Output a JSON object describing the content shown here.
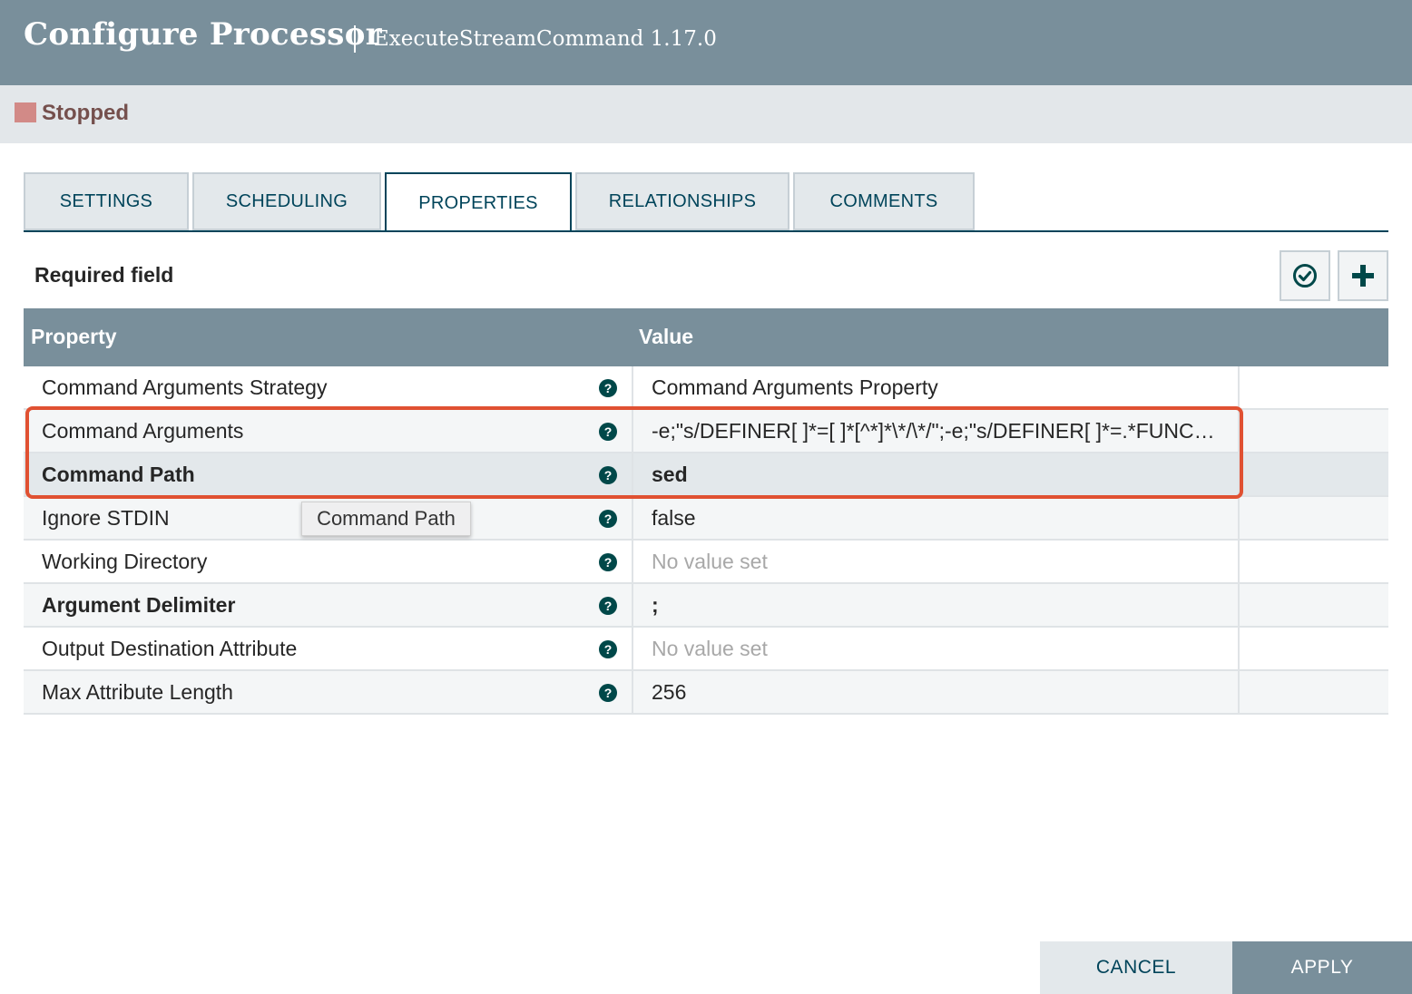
{
  "header": {
    "title": "Configure Processor",
    "subtitle": "ExecuteStreamCommand 1.17.0"
  },
  "status": {
    "label": "Stopped",
    "color": "#d28a87"
  },
  "tabs": [
    {
      "label": "SETTINGS",
      "active": false
    },
    {
      "label": "SCHEDULING",
      "active": false
    },
    {
      "label": "PROPERTIES",
      "active": true
    },
    {
      "label": "RELATIONSHIPS",
      "active": false
    },
    {
      "label": "COMMENTS",
      "active": false
    }
  ],
  "required_label": "Required field",
  "toolbar": {
    "verify_icon": "check-circle-icon",
    "add_icon": "plus-icon"
  },
  "table": {
    "headers": {
      "property": "Property",
      "value": "Value"
    },
    "rows": [
      {
        "name": "Command Arguments Strategy",
        "value": "Command Arguments Property",
        "required": false,
        "empty": false
      },
      {
        "name": "Command Arguments",
        "value": "-e;\"s/DEFINER[ ]*=[ ]*[^*]*\\*/\\*/\";-e;\"s/DEFINER[ ]*=.*FUNCTION",
        "required": false,
        "empty": false
      },
      {
        "name": "Command Path",
        "value": "sed",
        "required": true,
        "empty": false
      },
      {
        "name": "Ignore STDIN",
        "value": "false",
        "required": false,
        "empty": false
      },
      {
        "name": "Working Directory",
        "value": "No value set",
        "required": false,
        "empty": true
      },
      {
        "name": "Argument Delimiter",
        "value": ";",
        "required": true,
        "empty": false
      },
      {
        "name": "Output Destination Attribute",
        "value": "No value set",
        "required": false,
        "empty": true
      },
      {
        "name": "Max Attribute Length",
        "value": "256",
        "required": false,
        "empty": false
      }
    ]
  },
  "tooltip": "Command Path",
  "buttons": {
    "cancel": "CANCEL",
    "apply": "APPLY"
  },
  "colors": {
    "header": "#798f9b",
    "accent": "#00445a",
    "highlight": "#e05132"
  }
}
